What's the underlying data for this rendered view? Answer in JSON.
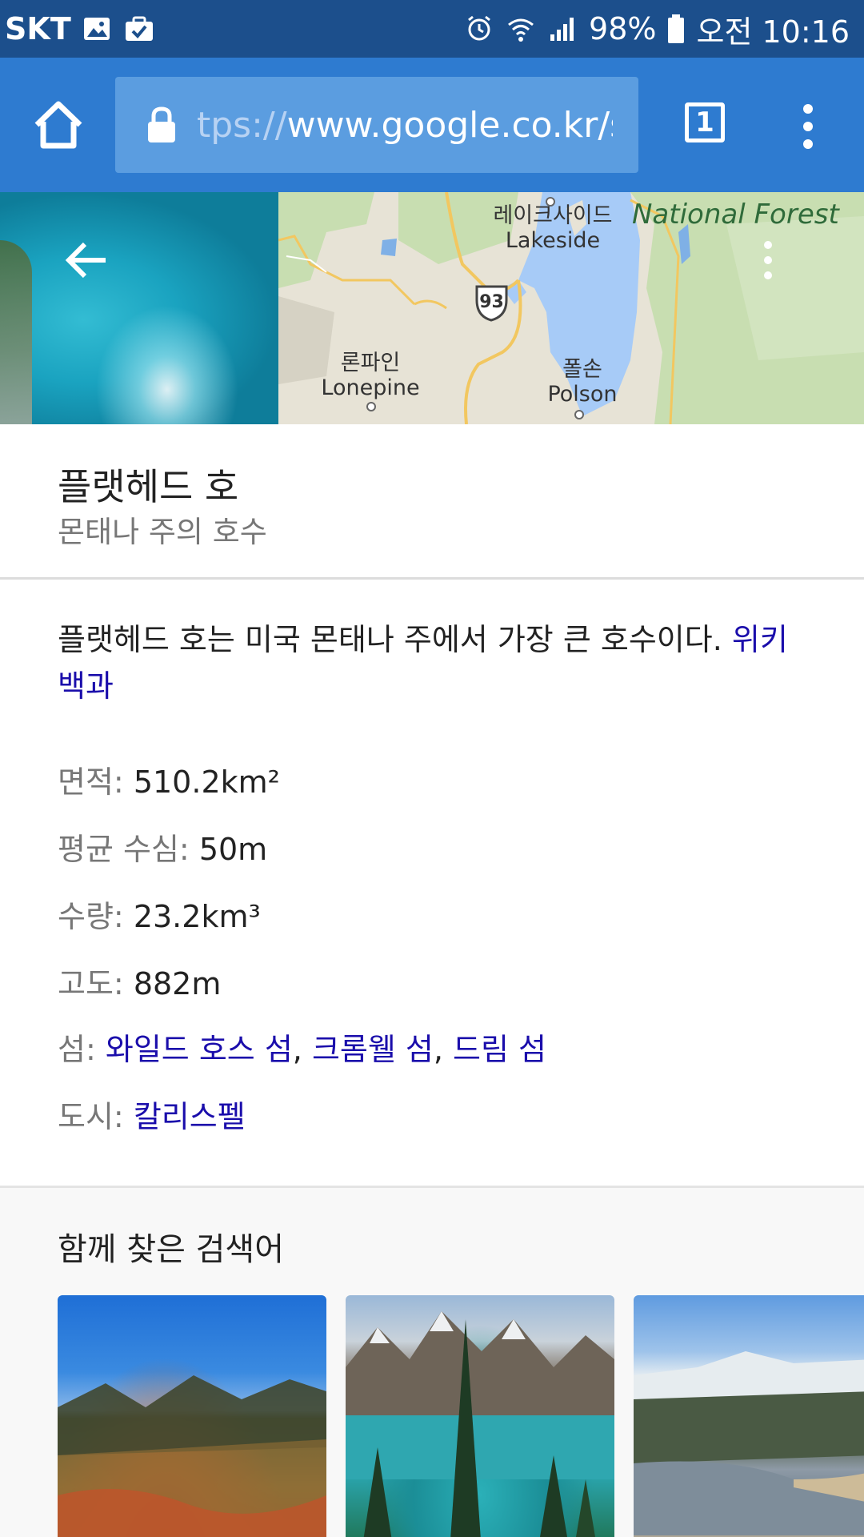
{
  "status_bar": {
    "carrier": "SKT",
    "battery": "98%",
    "time": "오전 10:16",
    "icons": [
      "image-icon",
      "briefcase-check-icon",
      "alarm-icon",
      "wifi-icon",
      "signal-icon",
      "battery-icon"
    ]
  },
  "toolbar": {
    "url_prefix": "tps://",
    "url_rest": "www.google.co.kr/s",
    "tab_count": "1"
  },
  "hero": {
    "map_labels": {
      "lakeside_ko": "레이크사이드",
      "lakeside_en": "Lakeside",
      "forest": "National Forest",
      "highway": "93",
      "lonepine_ko": "론파인",
      "lonepine_en": "Lonepine",
      "polson_ko": "폴손",
      "polson_en": "Polson"
    },
    "colors": {
      "map_land": "#e7e3d6",
      "map_water": "#a7cbf7",
      "map_forest": "#c8deb1"
    }
  },
  "entity": {
    "title": "플랫헤드 호",
    "subtitle": "몬태나 주의 호수"
  },
  "description": {
    "text": "플랫헤드 호는 미국 몬태나 주에서 가장 큰 호수이다. ",
    "source_link": "위키백과"
  },
  "facts": {
    "area": {
      "label": "면적:",
      "value": "510.2km²"
    },
    "mean_depth": {
      "label": "평균 수심:",
      "value": "50m"
    },
    "volume": {
      "label": "수량:",
      "value": "23.2km³"
    },
    "elevation": {
      "label": "고도:",
      "value": "882m"
    },
    "islands": {
      "label": "섬:",
      "links": [
        "와일드 호스 섬",
        "크롬웰 섬",
        "드림 섬"
      ],
      "separator": ", "
    },
    "city": {
      "label": "도시:",
      "link": "칼리스펠"
    }
  },
  "related": {
    "heading": "함께 찾은 검색어"
  },
  "theme": {
    "toolbar_blue": "#2e7bd0",
    "statusbar_blue": "#1c4f8c",
    "link_color": "#1a0dab"
  }
}
